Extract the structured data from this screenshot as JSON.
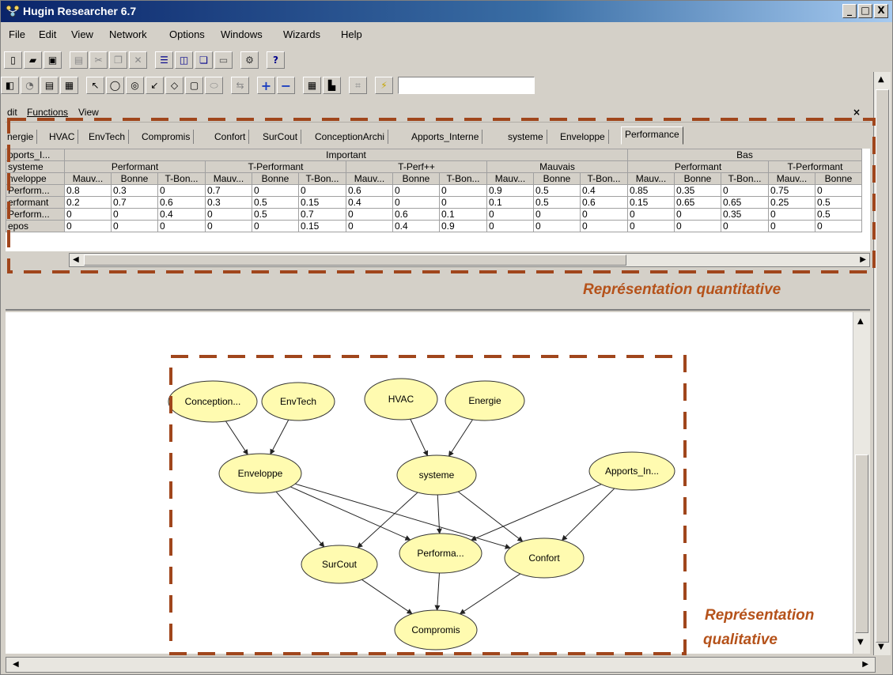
{
  "window": {
    "title": "Hugin Researcher 6.7"
  },
  "window_buttons": {
    "minimize": "_",
    "maximize": "□",
    "close": "X"
  },
  "menu": [
    "File",
    "Edit",
    "View",
    "Network",
    "Options",
    "Windows",
    "Wizards",
    "Help"
  ],
  "inner_menu": {
    "items": [
      "dit",
      "Functions",
      "View"
    ],
    "close": "×"
  },
  "tabs": [
    "nergie",
    "HVAC",
    "EnvTech",
    "Compromis",
    "Confort",
    "SurCout",
    "ConceptionArchi",
    "Apports_Interne",
    "systeme",
    "Enveloppe",
    "Performance"
  ],
  "active_tab": "Performance",
  "cpt": {
    "row_labels": [
      "pports_I...",
      "systeme",
      "nveloppe"
    ],
    "level1": [
      "Important",
      "Bas"
    ],
    "level2": [
      "Performant",
      "T-Performant",
      "T-Perf++",
      "Mauvais",
      "Performant",
      "T-Performant"
    ],
    "level3": [
      "Mauv...",
      "Bonne",
      "T-Bon...",
      "Mauv...",
      "Bonne",
      "T-Bon...",
      "Mauv...",
      "Bonne",
      "T-Bon...",
      "Mauv...",
      "Bonne",
      "T-Bon...",
      "Mauv...",
      "Bonne",
      "T-Bon...",
      "Mauv...",
      "Bonne"
    ],
    "rows": [
      {
        "label": "Perform...",
        "values": [
          "0.8",
          "0.3",
          "0",
          "0.7",
          "0",
          "0",
          "0.6",
          "0",
          "0",
          "0.9",
          "0.5",
          "0.4",
          "0.85",
          "0.35",
          "0",
          "0.75",
          "0"
        ]
      },
      {
        "label": "erformant",
        "values": [
          "0.2",
          "0.7",
          "0.6",
          "0.3",
          "0.5",
          "0.15",
          "0.4",
          "0",
          "0",
          "0.1",
          "0.5",
          "0.6",
          "0.15",
          "0.65",
          "0.65",
          "0.25",
          "0.5"
        ]
      },
      {
        "label": "Perform...",
        "values": [
          "0",
          "0",
          "0.4",
          "0",
          "0.5",
          "0.7",
          "0",
          "0.6",
          "0.1",
          "0",
          "0",
          "0",
          "0",
          "0",
          "0.35",
          "0",
          "0.5"
        ]
      },
      {
        "label": "epos",
        "values": [
          "0",
          "0",
          "0",
          "0",
          "0",
          "0.15",
          "0",
          "0.4",
          "0.9",
          "0",
          "0",
          "0",
          "0",
          "0",
          "0",
          "0",
          "0"
        ]
      }
    ]
  },
  "annotations": {
    "quantitative": "Représentation quantitative",
    "qualitative_line1": "Représentation",
    "qualitative_line2": "qualitative"
  },
  "colors": {
    "annotation": "#b5521a",
    "node_fill": "#fffbb0",
    "dash": "#a0461c"
  },
  "network": {
    "nodes": [
      {
        "id": "conception",
        "label": "Conception..."
      },
      {
        "id": "envtech",
        "label": "EnvTech"
      },
      {
        "id": "hvac",
        "label": "HVAC"
      },
      {
        "id": "energie",
        "label": "Energie"
      },
      {
        "id": "enveloppe",
        "label": "Enveloppe"
      },
      {
        "id": "systeme",
        "label": "systeme"
      },
      {
        "id": "apports",
        "label": "Apports_In..."
      },
      {
        "id": "surcout",
        "label": "SurCout"
      },
      {
        "id": "performa",
        "label": "Performa..."
      },
      {
        "id": "confort",
        "label": "Confort"
      },
      {
        "id": "compromis",
        "label": "Compromis"
      }
    ],
    "edges": [
      [
        "conception",
        "enveloppe"
      ],
      [
        "envtech",
        "enveloppe"
      ],
      [
        "hvac",
        "systeme"
      ],
      [
        "energie",
        "systeme"
      ],
      [
        "enveloppe",
        "surcout"
      ],
      [
        "enveloppe",
        "performa"
      ],
      [
        "enveloppe",
        "confort"
      ],
      [
        "systeme",
        "surcout"
      ],
      [
        "systeme",
        "performa"
      ],
      [
        "systeme",
        "confort"
      ],
      [
        "apports",
        "performa"
      ],
      [
        "apports",
        "confort"
      ],
      [
        "surcout",
        "compromis"
      ],
      [
        "performa",
        "compromis"
      ],
      [
        "confort",
        "compromis"
      ]
    ]
  }
}
